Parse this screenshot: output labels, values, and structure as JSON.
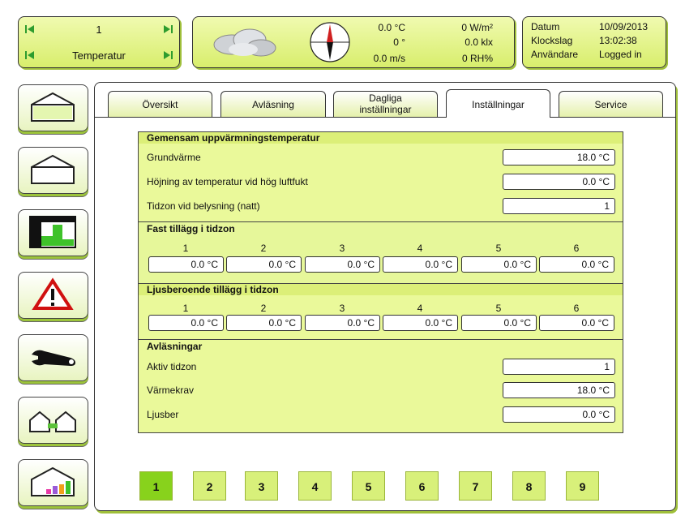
{
  "nav": {
    "top_value": "1",
    "bottom_value": "Temperatur"
  },
  "weather": {
    "temp": "0.0 °C",
    "direction": "0 °",
    "wind": "0.0 m/s",
    "radiation": "0 W/m²",
    "light": "0.0 klx",
    "humidity": "0 RH%"
  },
  "datetime": {
    "date_label": "Datum",
    "date_value": "10/09/2013",
    "time_label": "Klockslag",
    "time_value": "13:02:38",
    "user_label": "Användare",
    "user_value": "Logged in"
  },
  "tabs": [
    "Översikt",
    "Avläsning",
    "Dagliga inställningar",
    "Inställningar",
    "Service"
  ],
  "tab_lines": {
    "dagliga_1": "Dagliga",
    "dagliga_2": "inställningar"
  },
  "active_tab": "Inställningar",
  "common_heating": {
    "title": "Gemensam uppvärmningstemperatur",
    "rows": [
      {
        "label": "Grundvärme",
        "value": "18.0 °C"
      },
      {
        "label": "Höjning av temperatur vid hög luftfukt",
        "value": "0.0 °C"
      },
      {
        "label": "Tidzon vid belysning (natt)",
        "value": "1"
      }
    ]
  },
  "fixed_addition": {
    "title": "Fast tillägg i tidzon",
    "zones": [
      "1",
      "2",
      "3",
      "4",
      "5",
      "6"
    ],
    "values": [
      "0.0 °C",
      "0.0 °C",
      "0.0 °C",
      "0.0 °C",
      "0.0 °C",
      "0.0 °C"
    ]
  },
  "light_addition": {
    "title": "Ljusberoende tillägg i tidzon",
    "zones": [
      "1",
      "2",
      "3",
      "4",
      "5",
      "6"
    ],
    "values": [
      "0.0 °C",
      "0.0 °C",
      "0.0 °C",
      "0.0 °C",
      "0.0 °C",
      "0.0 °C"
    ]
  },
  "readings": {
    "title": "Avläsningar",
    "rows": [
      {
        "label": "Aktiv tidzon",
        "value": "1"
      },
      {
        "label": "Värmekrav",
        "value": "18.0 °C"
      },
      {
        "label": "Ljusber",
        "value": "0.0 °C"
      }
    ]
  },
  "pages": [
    "1",
    "2",
    "3",
    "4",
    "5",
    "6",
    "7",
    "8",
    "9"
  ],
  "active_page": "1",
  "colors": {
    "accent": "#d8ee6c",
    "active_page": "#88d21c",
    "panel": "#eaf99a"
  }
}
